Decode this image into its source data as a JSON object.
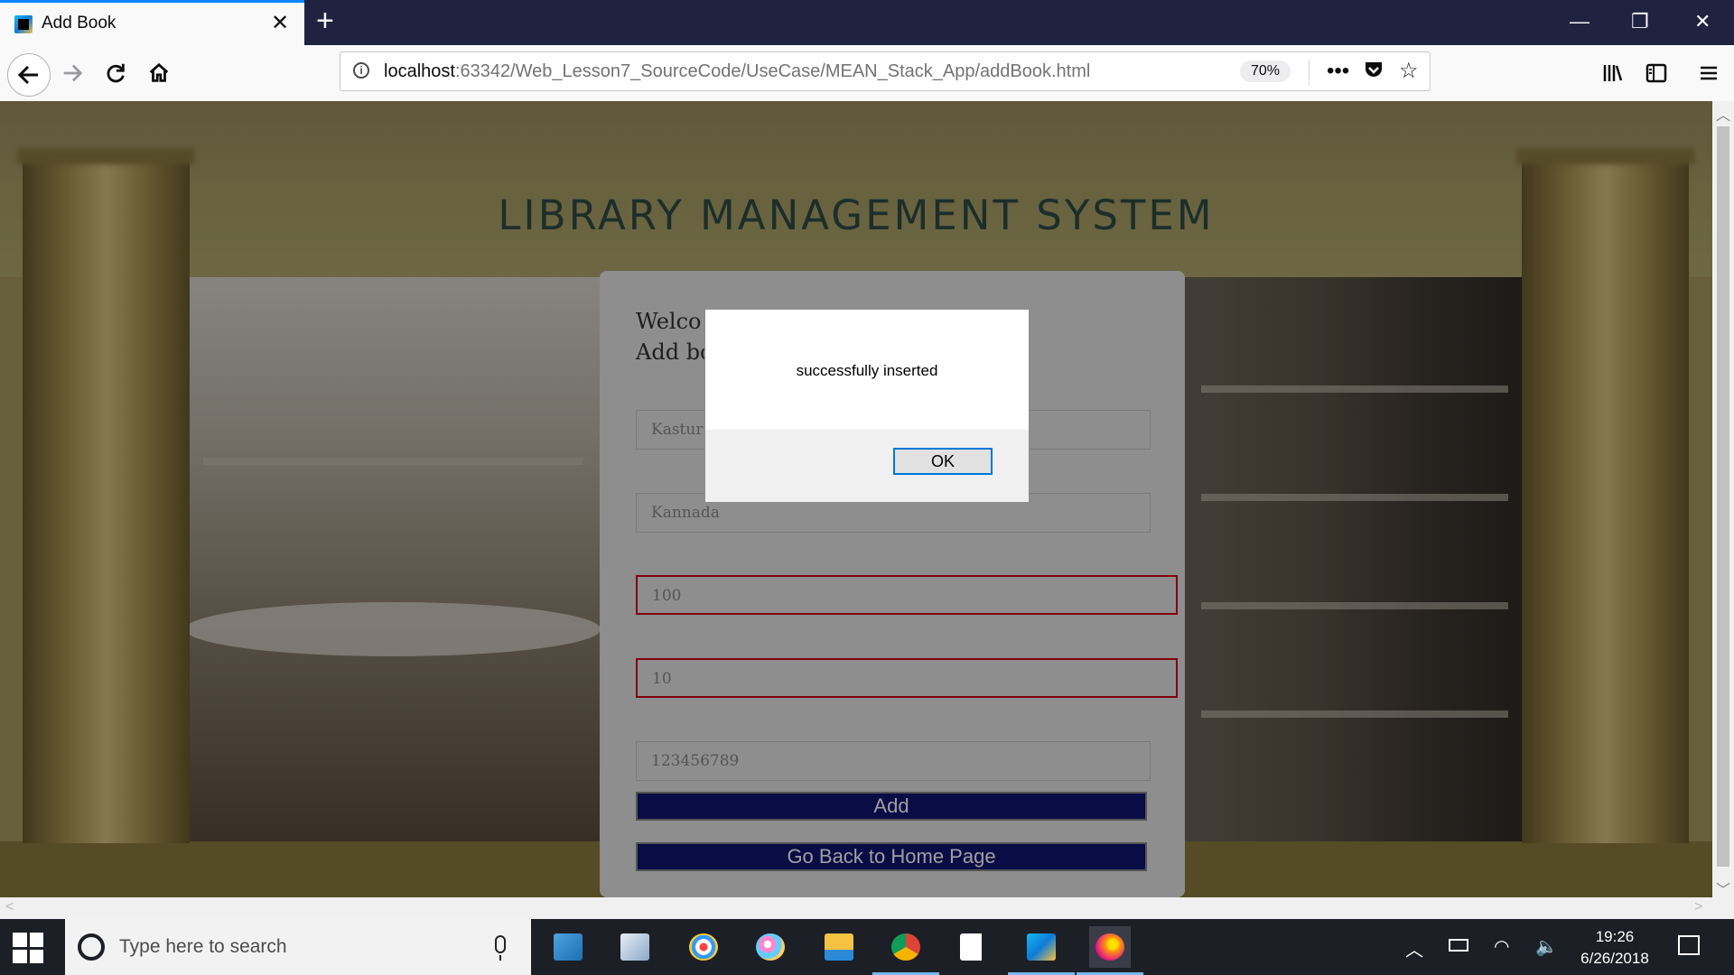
{
  "browser": {
    "tab_title": "Add Book",
    "tab_close": "✕",
    "new_tab": "+",
    "url_host": "localhost",
    "url_rest": ":63342/Web_Lesson7_SourceCode/UseCase/MEAN_Stack_App/addBook.html",
    "zoom": "70%",
    "window": {
      "minimize": "—",
      "restore": "❐",
      "close": "✕"
    }
  },
  "page": {
    "title": "LIBRARY MANAGEMENT SYSTEM",
    "welcome": "Welco",
    "add_heading": "Add bo",
    "fields": [
      {
        "value": "Kastur"
      },
      {
        "value": "Kannada"
      },
      {
        "value": "100"
      },
      {
        "value": "10"
      },
      {
        "value": "123456789"
      }
    ],
    "add_button": "Add",
    "home_button": "Go Back to Home Page"
  },
  "dialog": {
    "message": "successfully inserted",
    "ok_label": "OK"
  },
  "taskbar": {
    "search_placeholder": "Type here to search",
    "time": "19:26",
    "date": "6/26/2018",
    "apps": [
      "control-panel",
      "file-viewer",
      "paint",
      "paint-3d",
      "file-explorer",
      "chrome",
      "sticky-notes",
      "webstorm",
      "firefox"
    ]
  },
  "colors": {
    "accent_blue": "#0a84ff",
    "titlebar": "#202340",
    "button_navy": "#0f1470",
    "invalid_border": "#d0021b",
    "site_title": "#2f4b45"
  }
}
